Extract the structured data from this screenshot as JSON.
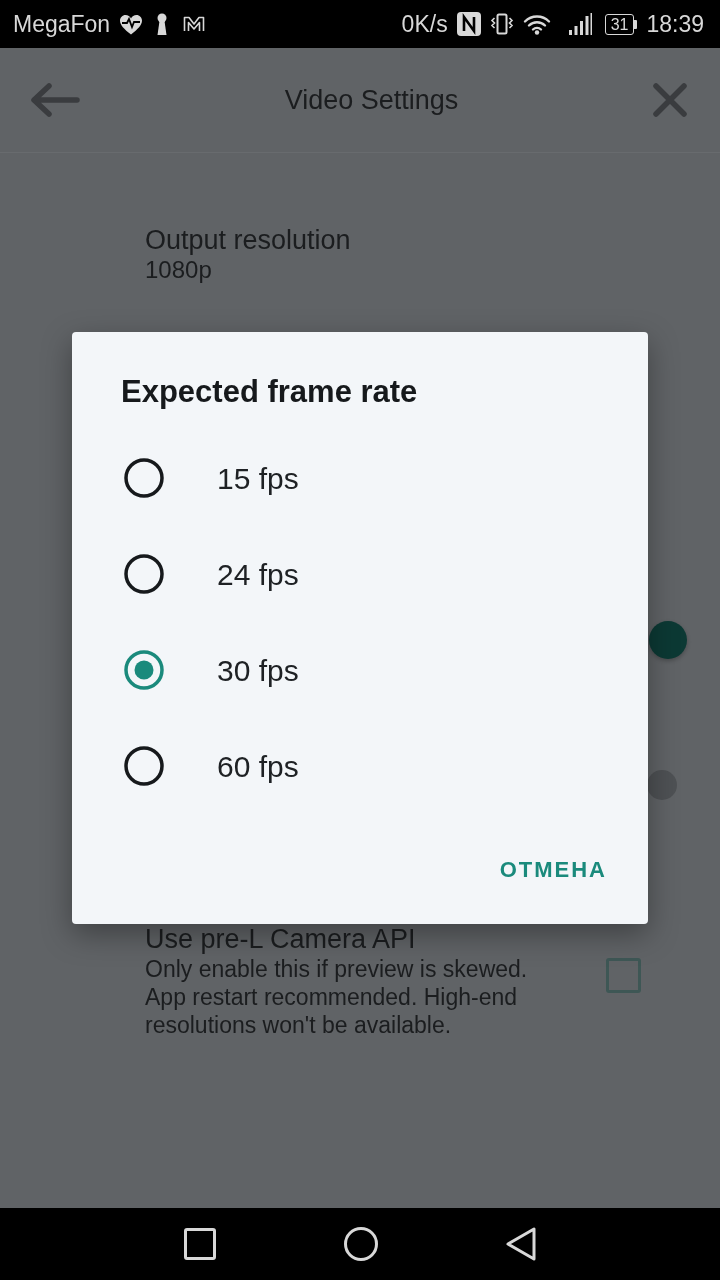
{
  "status_bar": {
    "carrier": "MegaFon",
    "network_speed": "0K/s",
    "battery": "31",
    "time": "18:39"
  },
  "app_bar": {
    "title": "Video Settings"
  },
  "settings": [
    {
      "kind": "text",
      "title": "Output resolution",
      "value": "1080p"
    },
    {
      "kind": "switch",
      "on": true
    },
    {
      "kind": "switch",
      "on": false
    },
    {
      "kind": "checkbox",
      "title": "Use pre-L Camera API",
      "summary": "Only enable this if preview is skewed. App restart recommended. High-end resolutions won't be available.",
      "checked": false
    }
  ],
  "dialog": {
    "title": "Expected frame rate",
    "options": [
      {
        "label": "15 fps",
        "selected": false
      },
      {
        "label": "24 fps",
        "selected": false
      },
      {
        "label": "30 fps",
        "selected": true
      },
      {
        "label": "60 fps",
        "selected": false
      }
    ],
    "buttons": [
      "ОТМЕНА"
    ]
  }
}
